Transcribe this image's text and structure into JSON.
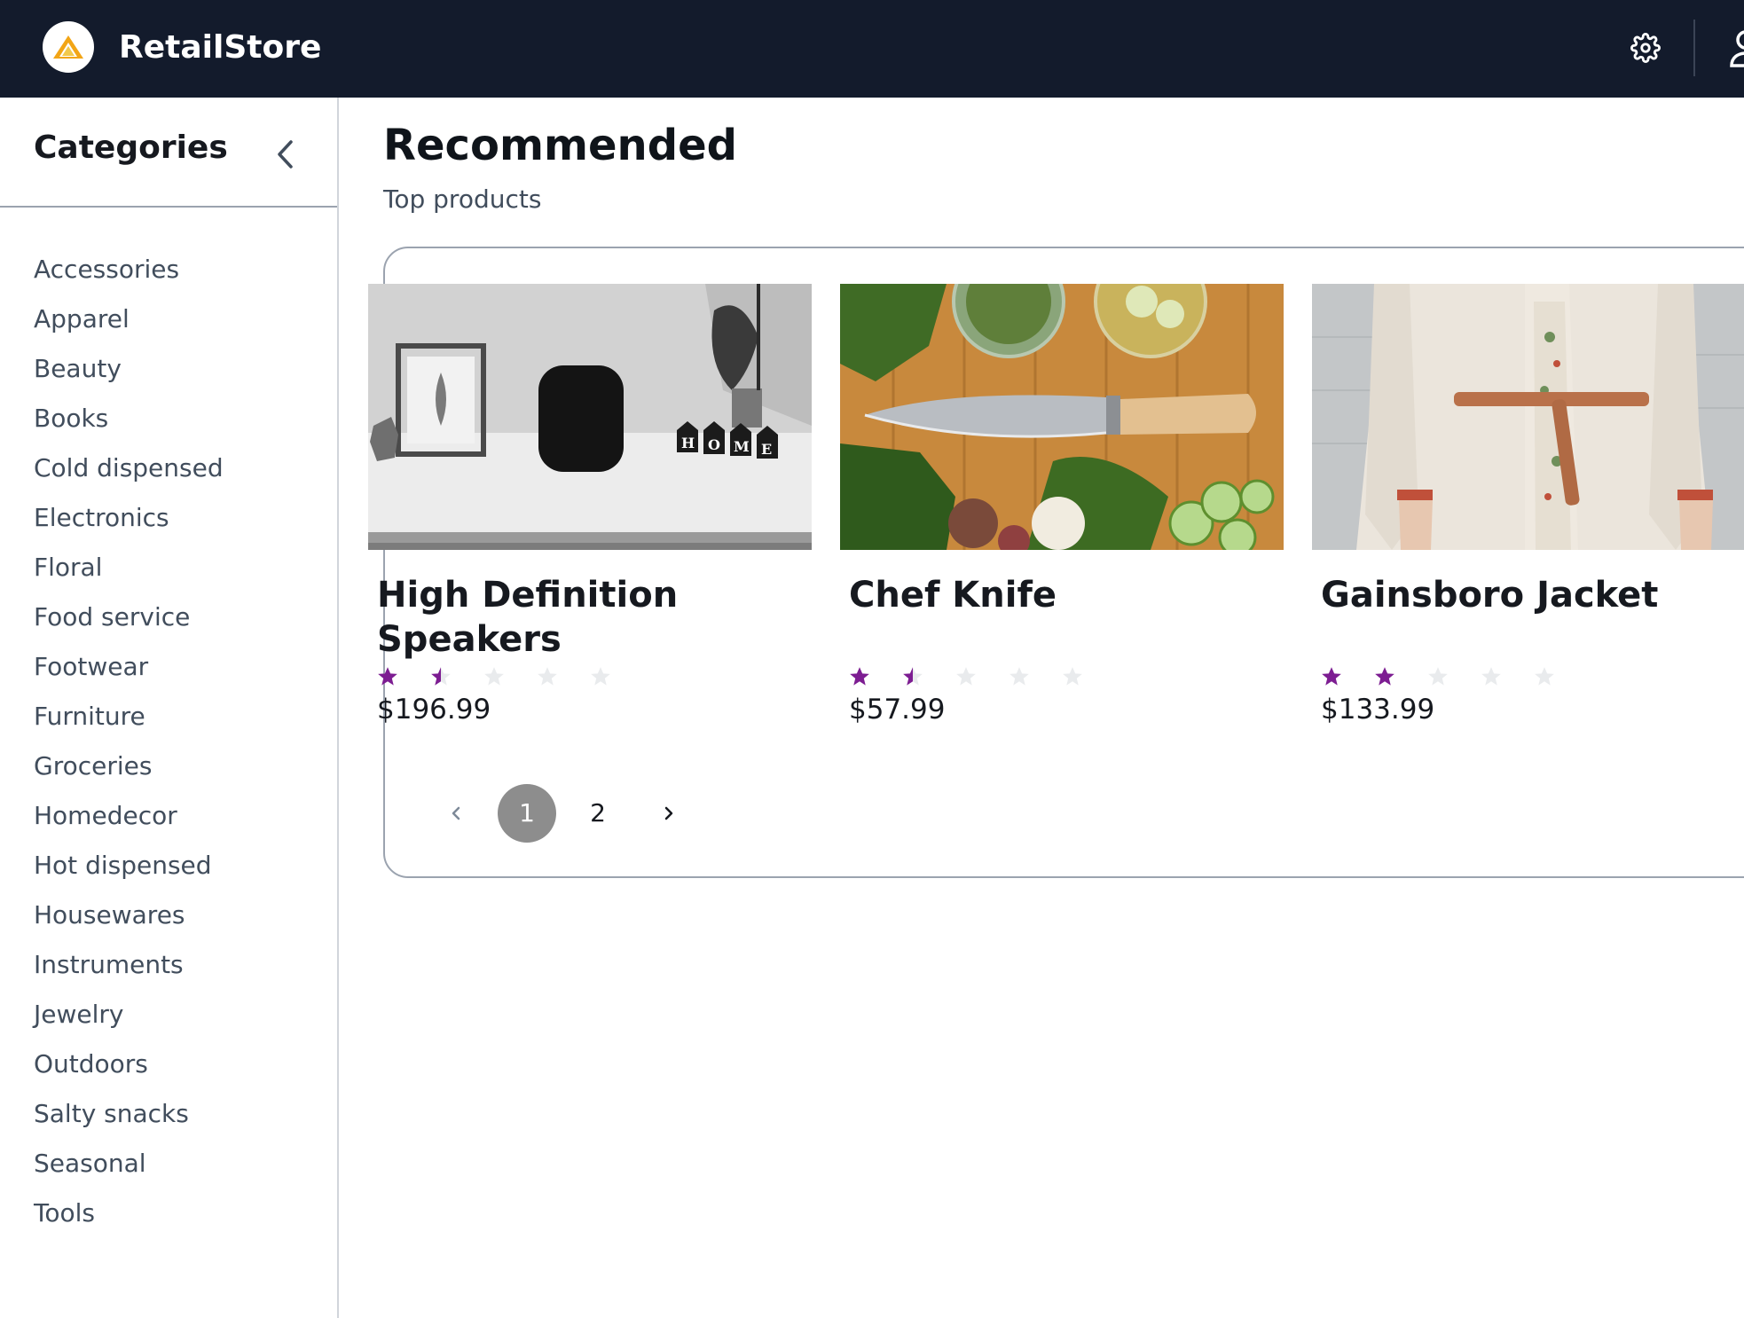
{
  "header": {
    "brand": "RetailStore",
    "logo_icon": "triangle-logo-icon",
    "settings_icon": "gear-icon",
    "user_icon": "user-icon"
  },
  "sidebar": {
    "title": "Categories",
    "collapse_icon": "chevron-left-icon",
    "categories": [
      "Accessories",
      "Apparel",
      "Beauty",
      "Books",
      "Cold dispensed",
      "Electronics",
      "Floral",
      "Food service",
      "Footwear",
      "Furniture",
      "Groceries",
      "Homedecor",
      "Hot dispensed",
      "Housewares",
      "Instruments",
      "Jewelry",
      "Outdoors",
      "Salty snacks",
      "Seasonal",
      "Tools"
    ]
  },
  "main": {
    "title": "Recommended",
    "subtitle": "Top products",
    "products": [
      {
        "name": "High Definition Speakers",
        "rating": 1.5,
        "max_rating": 5,
        "price": "$196.99"
      },
      {
        "name": "Chef Knife",
        "rating": 1.5,
        "max_rating": 5,
        "price": "$57.99"
      },
      {
        "name": "Gainsboro Jacket",
        "rating": 2,
        "max_rating": 5,
        "price": "$133.99"
      }
    ],
    "pagination": {
      "current": "1",
      "next_page": "2",
      "prev_icon": "chevron-left-icon",
      "next_icon": "chevron-right-icon"
    }
  },
  "colors": {
    "topbar": "#131b2c",
    "star_filled": "#7d1d92",
    "star_empty": "#e9ebed",
    "active_page": "#8d8d8d"
  }
}
